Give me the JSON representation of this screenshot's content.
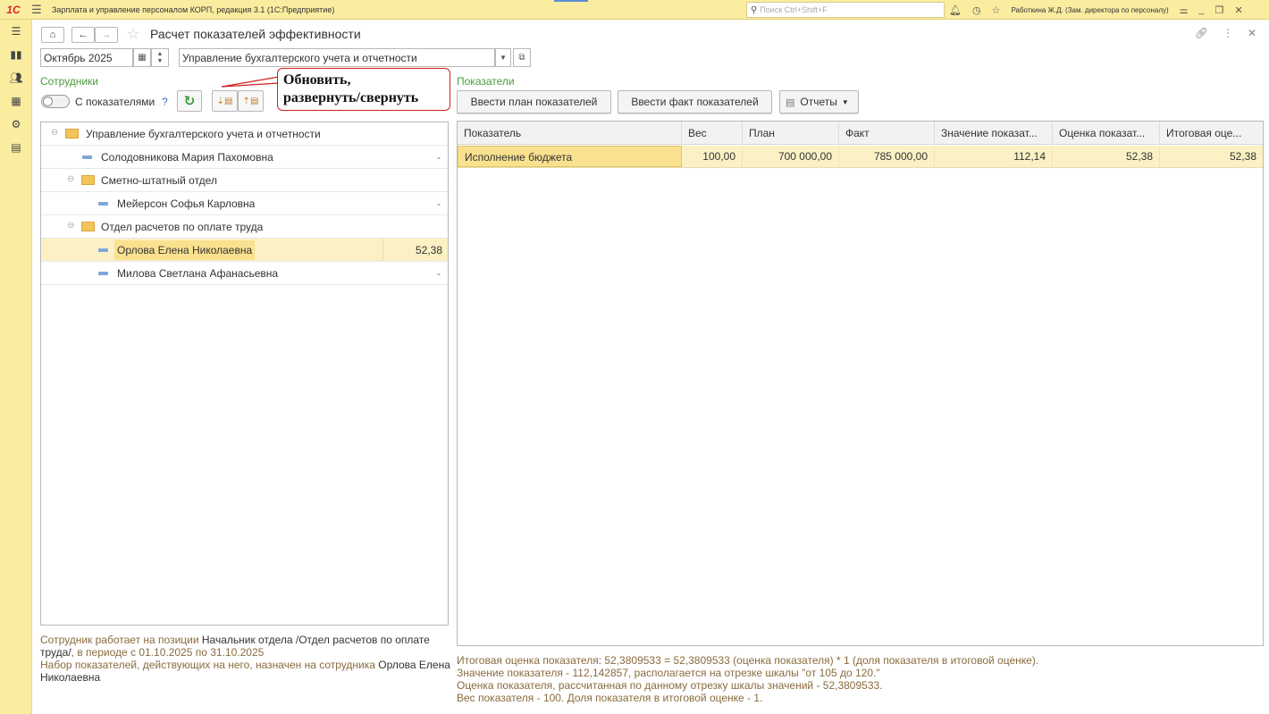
{
  "window": {
    "logo": "1С",
    "title": "Зарплата и управление персоналом КОРП, редакция 3.1  (1С:Предприятие)",
    "search_placeholder": "Поиск Ctrl+Shift+F",
    "user": "Работкина Ж.Д. (Зам. директора по персоналу)"
  },
  "form": {
    "title": "Расчет показателей эффективности",
    "period": "Октябрь 2025",
    "department": "Управление бухгалтерского учета и отчетности"
  },
  "employees": {
    "section_label": "Сотрудники",
    "toggle_label": "С показателями",
    "help": "?",
    "callout": "Обновить,\nразвернуть/свернуть",
    "tree": [
      {
        "type": "folder",
        "level": 0,
        "label": "Управление бухгалтерского учета и отчетности",
        "value": ""
      },
      {
        "type": "employee",
        "level": 1,
        "label": "Солодовникова Мария Пахомовна",
        "value": "-"
      },
      {
        "type": "folder",
        "level": 1,
        "label": "Сметно-штатный отдел",
        "value": ""
      },
      {
        "type": "employee",
        "level": 2,
        "label": "Мейерсон Софья Карловна",
        "value": "-"
      },
      {
        "type": "folder",
        "level": 1,
        "label": "Отдел расчетов по оплате труда",
        "value": ""
      },
      {
        "type": "employee",
        "level": 2,
        "label": "Орлова Елена Николаевна",
        "value": "52,38",
        "selected": true
      },
      {
        "type": "employee",
        "level": 2,
        "label": "Милова Светлана Афанасьевна",
        "value": "-"
      }
    ],
    "info": {
      "p1": "Сотрудник работает на позиции ",
      "position": "Начальник отдела /Отдел расчетов по оплате труда/",
      "p2": ", в периоде с 01.10.2025 по 31.10.2025",
      "p3": "Набор показателей, действующих на него, назначен на сотрудника ",
      "employee": "Орлова Елена Николаевна"
    }
  },
  "indicators": {
    "section_label": "Показатели",
    "btn_plan": "Ввести план показателей",
    "btn_fact": "Ввести факт показателей",
    "btn_reports": "Отчеты",
    "columns": [
      "Показатель",
      "Вес",
      "План",
      "Факт",
      "Значение показат...",
      "Оценка показат...",
      "Итоговая оце..."
    ],
    "rows": [
      [
        "Исполнение бюджета",
        "100,00",
        "700 000,00",
        "785 000,00",
        "112,14",
        "52,38",
        "52,38"
      ]
    ],
    "info": [
      "Итоговая оценка показателя: 52,3809533 = 52,3809533 (оценка показателя) * 1 (доля показателя в итоговой оценке).",
      "Значение показателя - 112,142857, располагается на отрезке шкалы \"от 105 до 120.\"",
      "Оценка показателя, рассчитанная по данному отрезку шкалы значений - 52,3809533.",
      "Вес показателя - 100. Доля показателя в итоговой оценке - 1."
    ]
  }
}
